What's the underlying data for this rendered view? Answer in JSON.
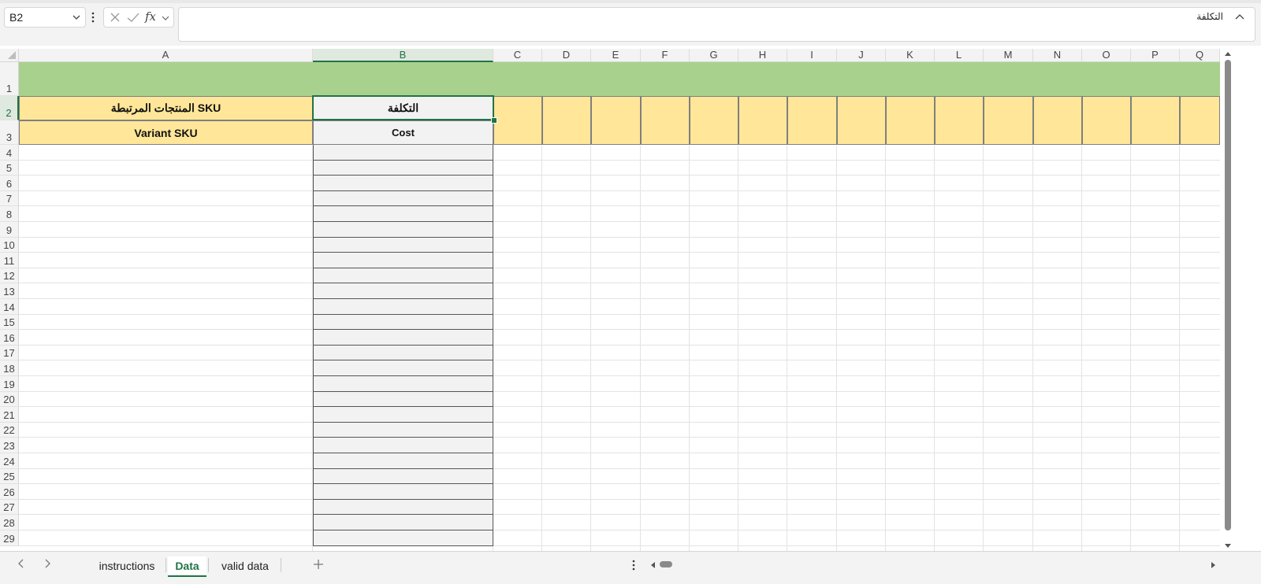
{
  "formula_bar": {
    "name_box": "B2",
    "formula_value": "التكلفة"
  },
  "grid": {
    "columns": [
      "A",
      "B",
      "C",
      "D",
      "E",
      "F",
      "G",
      "H",
      "I",
      "J",
      "K",
      "L",
      "M",
      "N",
      "O",
      "P",
      "Q"
    ],
    "rows": [
      "1",
      "2",
      "3",
      "4",
      "5",
      "6",
      "7",
      "8",
      "9",
      "10",
      "11",
      "12",
      "13",
      "14",
      "15",
      "16",
      "17",
      "18",
      "19",
      "20",
      "21",
      "22",
      "23",
      "24",
      "25",
      "26",
      "27",
      "28",
      "29"
    ],
    "selected_cell": "B2",
    "cells": {
      "A2": "SKU المنتجات المرتبطة",
      "A3": "Variant SKU",
      "B2": "التكلفة",
      "B3": "Cost"
    }
  },
  "colors": {
    "banner": "#a9d18e",
    "header_fill": "#ffe699",
    "cost_fill": "#f2f2f2",
    "accent": "#217346"
  },
  "sheet_tabs": [
    {
      "label": "instructions",
      "active": false
    },
    {
      "label": "Data",
      "active": true
    },
    {
      "label": "valid data",
      "active": false
    }
  ],
  "icons": [
    "chevron-down-icon",
    "more-vertical-icon",
    "cancel-x-icon",
    "check-icon",
    "fx-icon",
    "collapse-chevron-icon",
    "select-all-corner-icon",
    "prev-sheet-icon",
    "next-sheet-icon",
    "add-sheet-icon",
    "scroll-left-icon",
    "scroll-right-icon",
    "scroll-up-icon",
    "scroll-down-icon"
  ]
}
